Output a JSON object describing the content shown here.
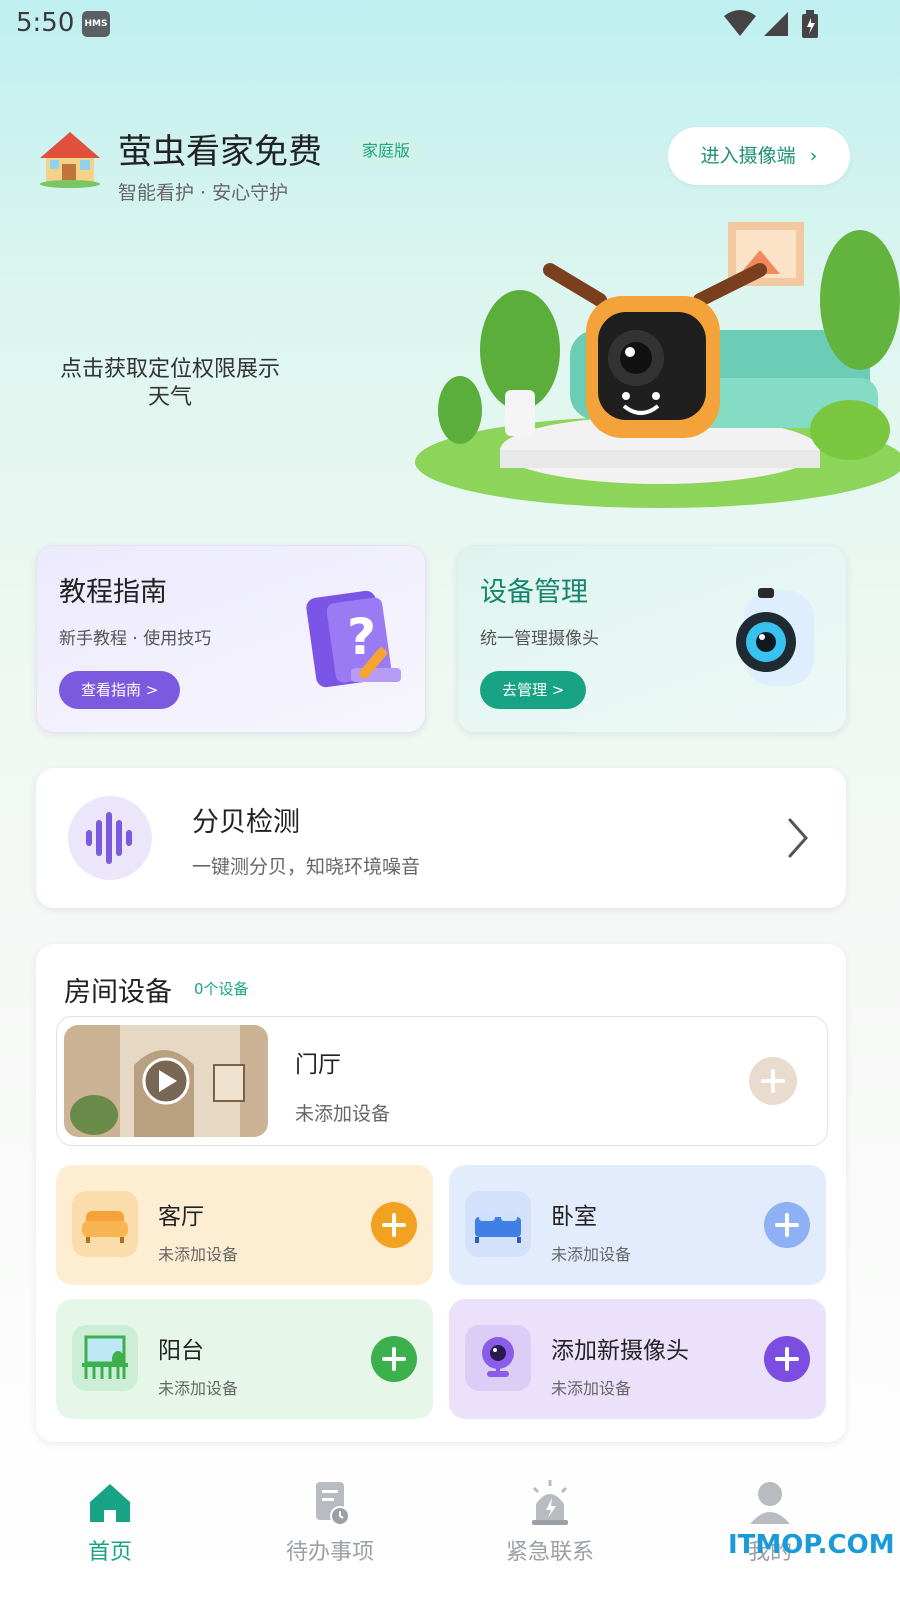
{
  "status_bar": {
    "time": "5:50",
    "badge": "HMS"
  },
  "header": {
    "title": "萤虫看家免费",
    "edition": "家庭版",
    "subtitle": "智能看护 · 安心守护",
    "camera_entry": "进入摄像端"
  },
  "weather_tip": "点击获取定位权限展示天气",
  "cards": {
    "tutorial": {
      "title": "教程指南",
      "subtitle": "新手教程 · 使用技巧",
      "button": "查看指南 >"
    },
    "device": {
      "title": "设备管理",
      "subtitle": "统一管理摄像头",
      "button": "去管理 >"
    }
  },
  "decibel": {
    "title": "分贝检测",
    "subtitle": "一键测分贝，知晓环境噪音"
  },
  "rooms": {
    "title": "房间设备",
    "count": "0个设备",
    "hall": {
      "name": "门厅",
      "status": "未添加设备"
    },
    "tiles": [
      {
        "name": "客厅",
        "status": "未添加设备",
        "accent": "#f2a221"
      },
      {
        "name": "卧室",
        "status": "未添加设备",
        "accent": "#8eb0f5"
      },
      {
        "name": "阳台",
        "status": "未添加设备",
        "accent": "#3bb04d"
      },
      {
        "name": "添加新摄像头",
        "status": "未添加设备",
        "accent": "#7b4de0"
      }
    ]
  },
  "nav": [
    {
      "label": "首页",
      "icon": "home-icon",
      "active": true
    },
    {
      "label": "待办事项",
      "icon": "todo-icon",
      "active": false
    },
    {
      "label": "紧急联系",
      "icon": "alarm-icon",
      "active": false
    },
    {
      "label": "我的",
      "icon": "profile-icon",
      "active": false
    }
  ],
  "watermark": "ITMOP.COM",
  "colors": {
    "primary": "#18a484",
    "purple": "#7b5ae0"
  }
}
